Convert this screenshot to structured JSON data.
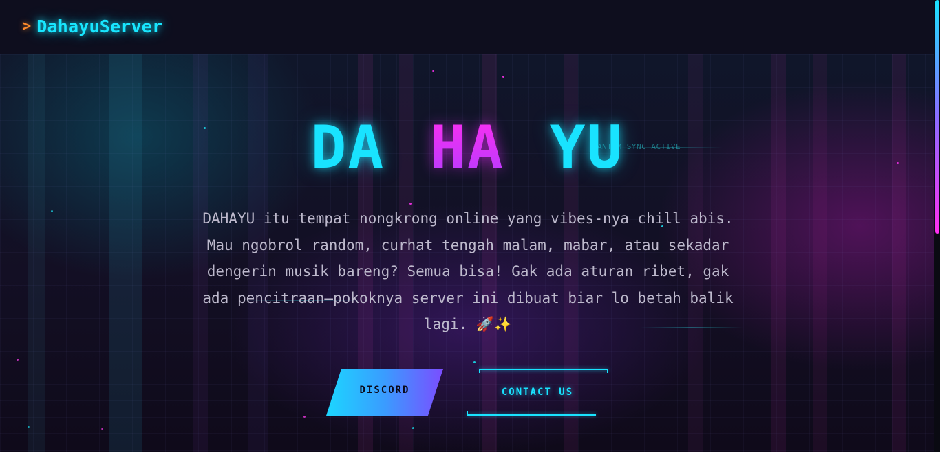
{
  "navbar": {
    "brand_chevron": ">",
    "brand_name": "DahayuServer"
  },
  "hero": {
    "title_parts": [
      "DA",
      "HA",
      "YU"
    ],
    "sync_tag": "ANTUM SYNC ACTIVE",
    "description": "DAHAYU itu tempat nongkrong online yang vibes-nya chill abis. Mau ngobrol random, curhat tengah malam, mabar, atau sekadar dengerin musik bareng? Semua bisa! Gak ada aturan ribet, gak ada pencitraan—pokoknya server ini dibuat biar lo betah balik lagi. 🚀✨",
    "buttons": {
      "discord_label": "DISCORD",
      "contact_label": "CONTACT US"
    }
  },
  "icons": {
    "brand": "chevron-right-icon",
    "description_emoji": [
      "rocket-icon",
      "sparkles-icon"
    ]
  },
  "colors": {
    "accent_cyan": "#19e3ff",
    "accent_magenta": "#ff2ef0",
    "accent_orange": "#ff8a2a",
    "background": "#0b0a16"
  }
}
